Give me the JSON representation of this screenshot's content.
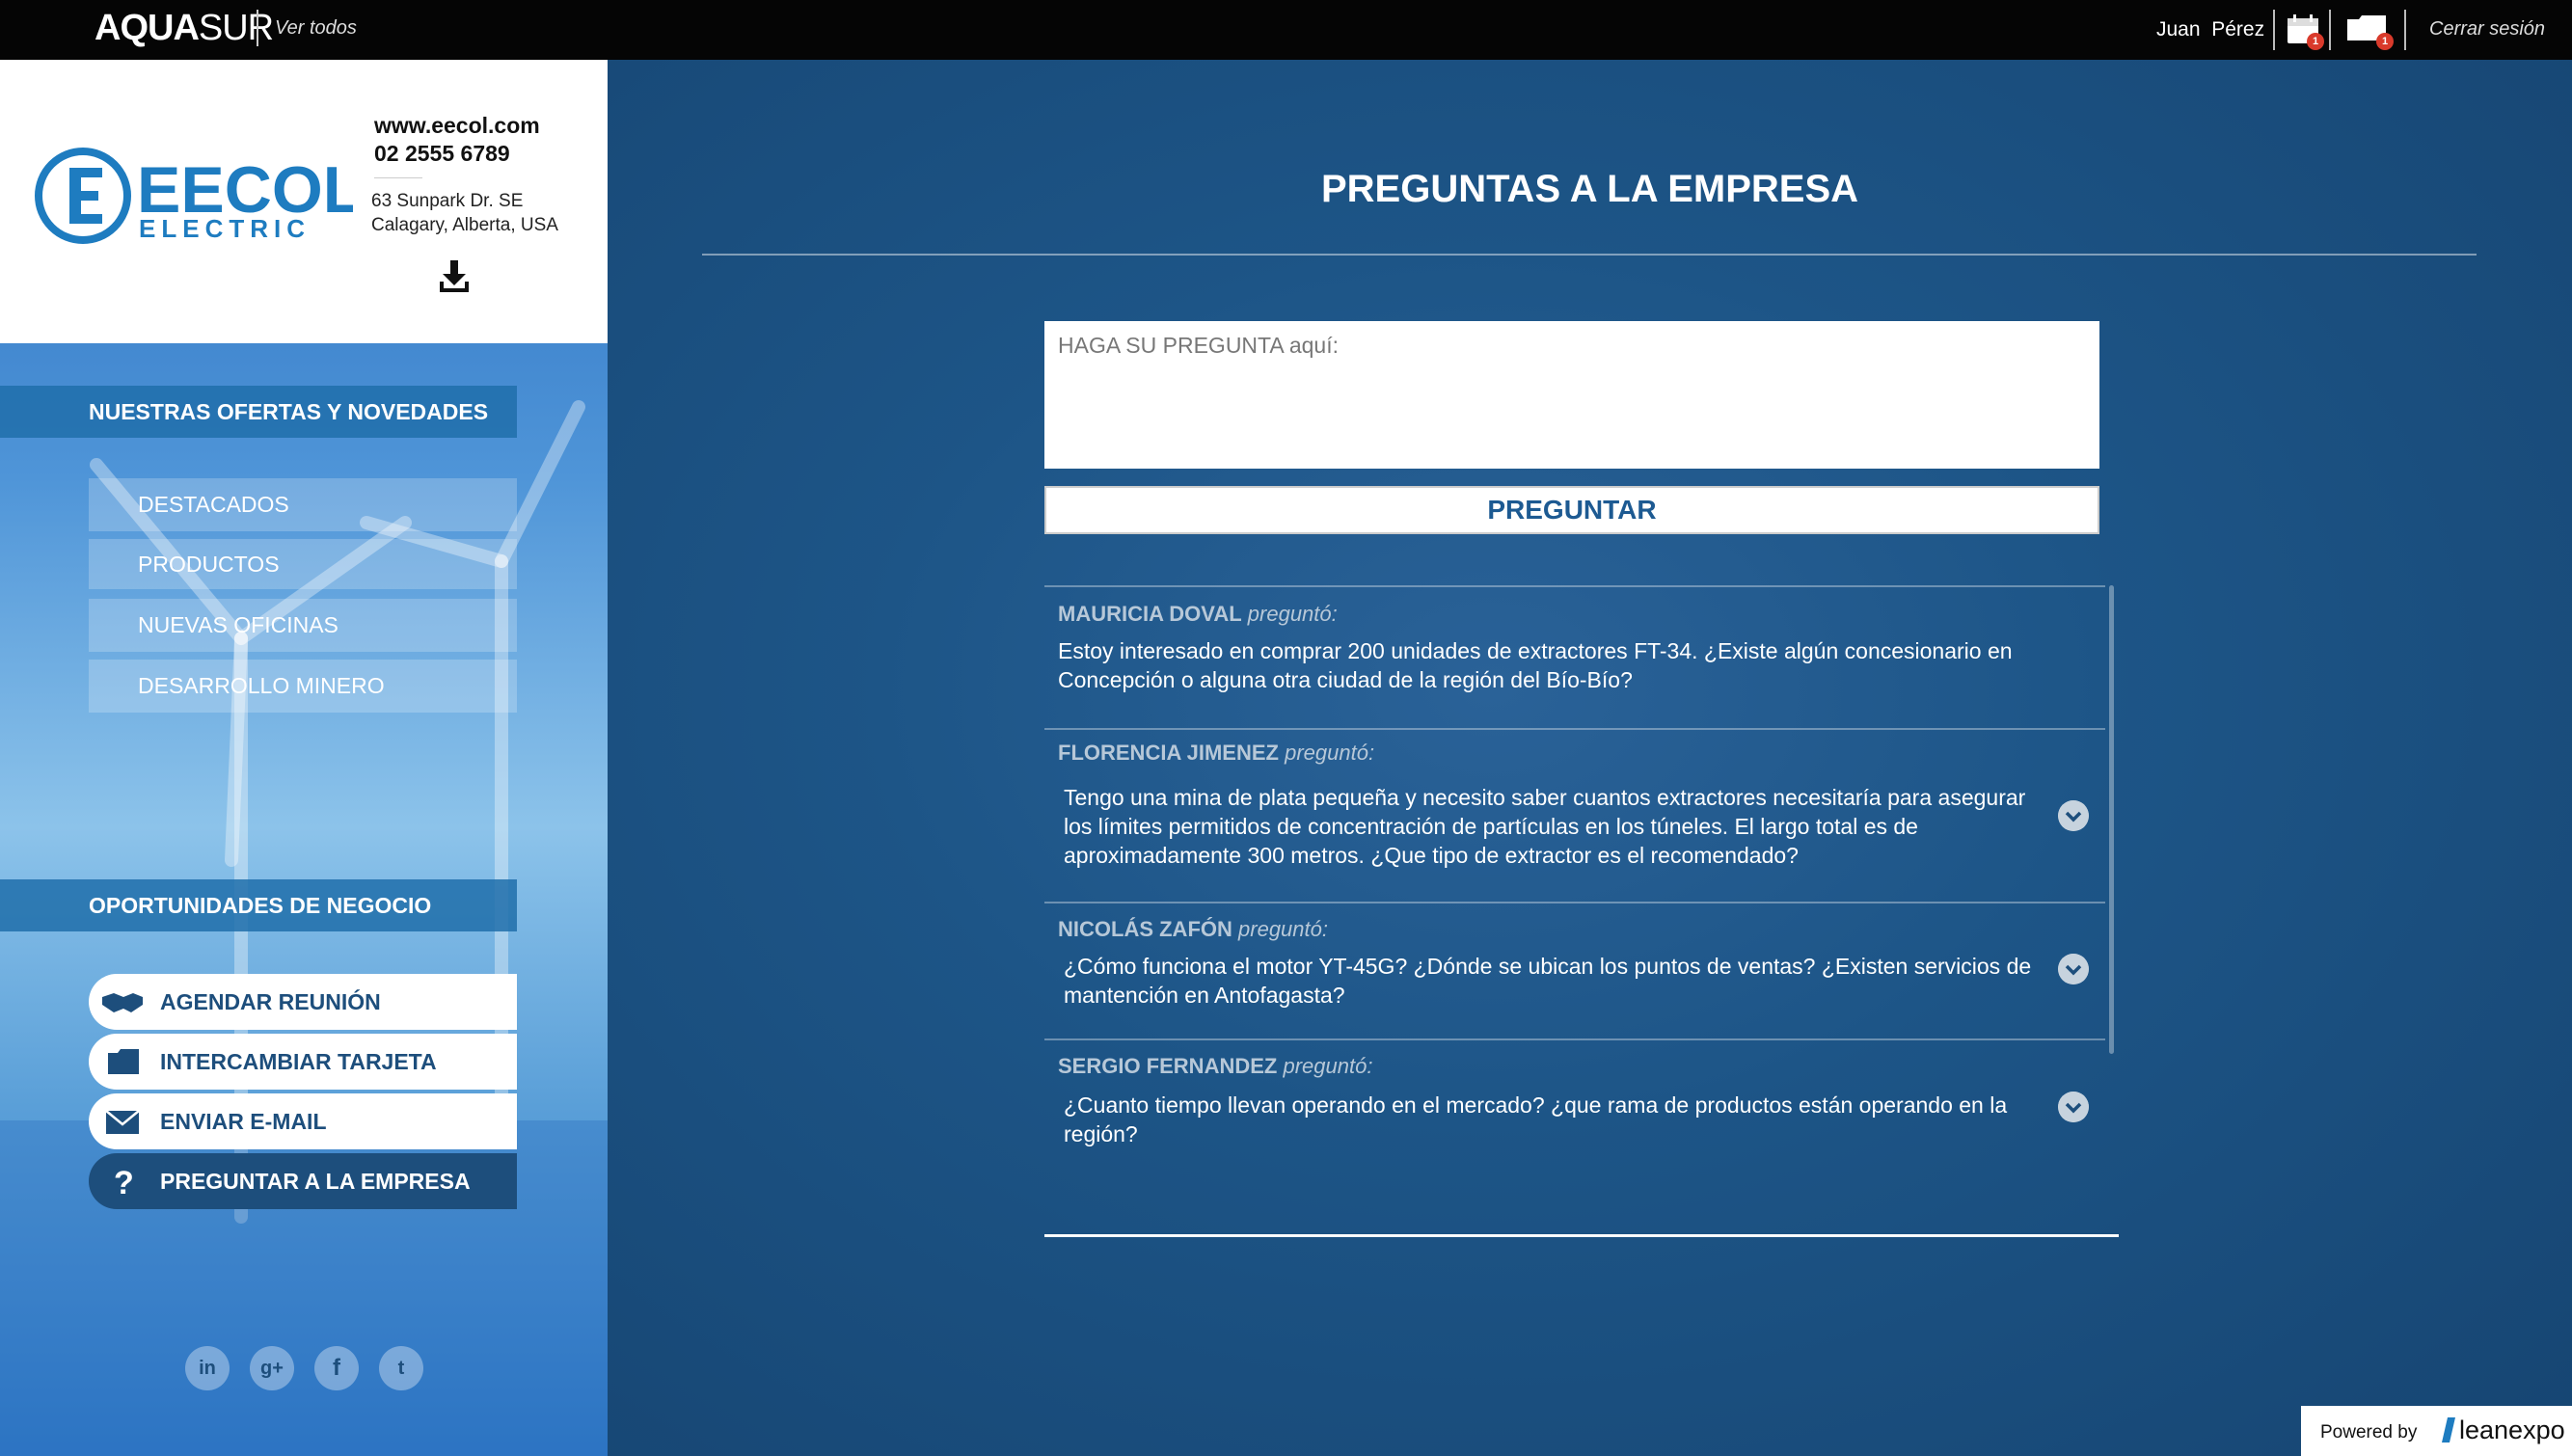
{
  "topbar": {
    "brand": "AQUASUR",
    "brand_bold": "AQUA",
    "brand_thin": "SUR",
    "view_all": "Ver todos",
    "user_first": "Juan",
    "user_last": "Pérez",
    "calendar_badge": "1",
    "card_badge": "1",
    "logout": "Cerrar sesión",
    "icons": {
      "calendar": "calendar-icon",
      "card": "folder-icon"
    }
  },
  "company": {
    "logo_main": "EECOL",
    "logo_sub": "ELECTRIC",
    "website": "www.eecol.com",
    "phone": "02 2555 6789",
    "address_line1": "63 Sunpark Dr. SE",
    "address_line2": "Calagary, Alberta, USA",
    "download_icon": "download-icon"
  },
  "sidebar": {
    "offers_title": "NUESTRAS OFERTAS Y NOVEDADES",
    "offers": [
      {
        "label": "DESTACADOS"
      },
      {
        "label": "PRODUCTOS"
      },
      {
        "label": "NUEVAS OFICINAS"
      },
      {
        "label": "DESARROLLO MINERO"
      }
    ],
    "business_title": "OPORTUNIDADES DE NEGOCIO",
    "actions": [
      {
        "label": "AGENDAR REUNIÓN",
        "icon": "handshake-icon"
      },
      {
        "label": "INTERCAMBIAR TARJETA",
        "icon": "card-icon"
      },
      {
        "label": "ENVIAR E-MAIL",
        "icon": "envelope-icon"
      },
      {
        "label": "PREGUNTAR A LA EMPRESA",
        "icon": "question-icon",
        "active": true
      }
    ],
    "social": [
      {
        "label": "in",
        "icon": "linkedin-icon"
      },
      {
        "label": "g+",
        "icon": "google-plus-icon"
      },
      {
        "label": "f",
        "icon": "facebook-icon"
      },
      {
        "label": "t",
        "icon": "twitter-icon"
      }
    ]
  },
  "main": {
    "title": "PREGUNTAS A LA EMPRESA",
    "question_placeholder": "HAGA SU PREGUNTA aquí:",
    "ask_button": "PREGUNTAR",
    "asked_verb": "preguntó:",
    "questions": [
      {
        "name": "MAURICIA DOVAL",
        "text_line1": "Estoy interesado en comprar 200 unidades de extractores FT-34. ¿Existe algún concesionario en",
        "text_line2": "Concepción o alguna otra ciudad de la región del Bío-Bío?",
        "text_line3": ""
      },
      {
        "name": "FLORENCIA JIMENEZ",
        "text_line1": "Tengo una mina de plata pequeña y necesito saber cuantos extractores necesitaría para asegurar",
        "text_line2": "los límites permitidos de concentración de partículas en los túneles. El largo total es de",
        "text_line3": "aproximadamente 300 metros. ¿Que tipo de extractor es el recomendado?"
      },
      {
        "name": "NICOLÁS ZAFÓN",
        "text_line1": "¿Cómo funciona el motor YT-45G? ¿Dónde se ubican los puntos de ventas? ¿Existen servicios de",
        "text_line2": "mantención en Antofagasta?",
        "text_line3": ""
      },
      {
        "name": "SERGIO FERNANDEZ",
        "text_line1": "¿Cuanto tiempo llevan operando en el mercado? ¿que rama de productos están operando en la",
        "text_line2": "región?",
        "text_line3": ""
      }
    ]
  },
  "footer": {
    "powered_by": "Powered by",
    "powered_logo": "leanexpo"
  },
  "colors": {
    "topbar": "#050505",
    "main_bg": "#1d5587",
    "accent": "#1d4e7c",
    "badge": "#d93a2b",
    "brand_blue": "#1e7cc0"
  }
}
